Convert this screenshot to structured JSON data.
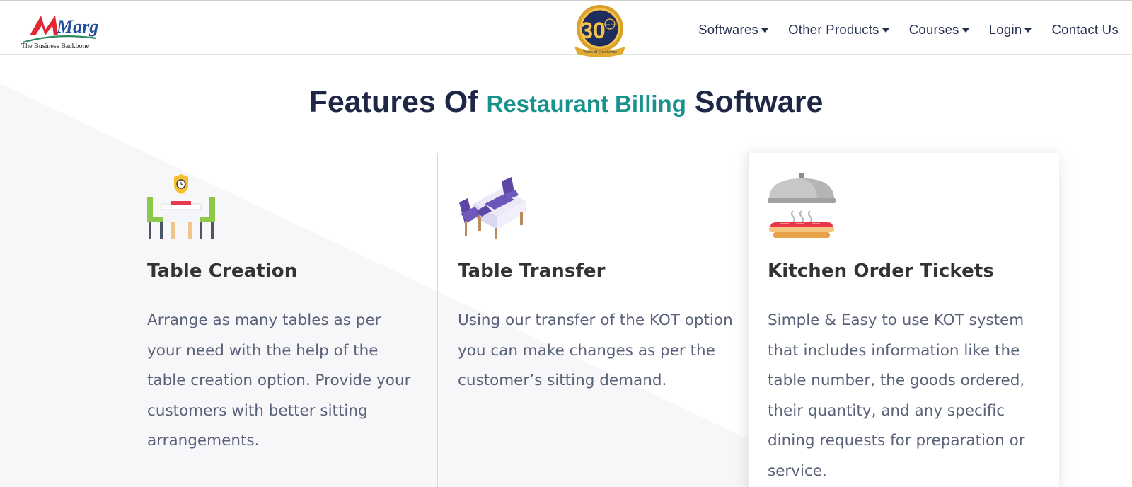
{
  "header": {
    "logo": {
      "brand": "Marg",
      "tagline": "The Business Backbone"
    },
    "badge": {
      "number": "30",
      "caption": "Years of Excellence",
      "sub": "Since 1992"
    },
    "nav": [
      {
        "label": "Softwares",
        "dropdown": true
      },
      {
        "label": "Other Products",
        "dropdown": true
      },
      {
        "label": "Courses",
        "dropdown": true
      },
      {
        "label": "Login",
        "dropdown": true
      },
      {
        "label": "Contact Us",
        "dropdown": false
      }
    ]
  },
  "heading": {
    "prefix": "Features Of",
    "highlight": "Restaurant Billing",
    "suffix": "Software"
  },
  "features": [
    {
      "icon": "table-creation-icon",
      "title": "Table Creation",
      "description": "Arrange as many tables as per your need with the help of the table creation option. Provide your customers with better sitting arrangements."
    },
    {
      "icon": "table-transfer-icon",
      "title": "Table Transfer",
      "description": "Using our transfer of the KOT option you can make changes as per the customer’s sitting demand."
    },
    {
      "icon": "kitchen-order-icon",
      "title": "Kitchen Order Tickets",
      "description": "Simple & Easy to use KOT system that includes information like the table number, the goods ordered, their quantity, and any specific dining requests for preparation or service."
    }
  ],
  "colors": {
    "heading": "#1f2747",
    "accent": "#17928c",
    "nav": "#24304f",
    "body_text": "#5a627a",
    "logo_red": "#e3262f",
    "logo_blue": "#1d4f9c"
  }
}
